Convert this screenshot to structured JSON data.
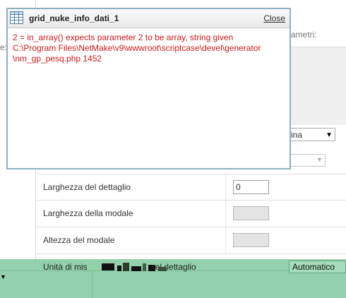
{
  "dialog": {
    "title": "grid_nuke_info_dati_1",
    "close_label": "Close",
    "error_lines": [
      "2 = in_array() expects parameter 2 to be array, string given",
      "C:\\Program Files\\NetMake\\v9\\wwwroot\\scriptcase\\devel\\generator",
      "\\nm_gp_pesq.php 1452"
    ]
  },
  "background": {
    "params_label_fragment": "ametri:",
    "left_fragment": "e:",
    "select_1_value": "ina",
    "rows": [
      {
        "label": "Larghezza del dettaglio",
        "value": "0"
      },
      {
        "label": "Larghezza della modale",
        "value": ""
      },
      {
        "label": "Altezza del modale",
        "value": ""
      }
    ],
    "unit_row": {
      "label_start": "Unità di mis",
      "label_end": "el dettaglio",
      "select_value": "Automatico"
    }
  },
  "colors": {
    "error_text": "#cc1a1a",
    "dialog_border": "#8fb0c2",
    "green_band": "#92d1ac"
  }
}
